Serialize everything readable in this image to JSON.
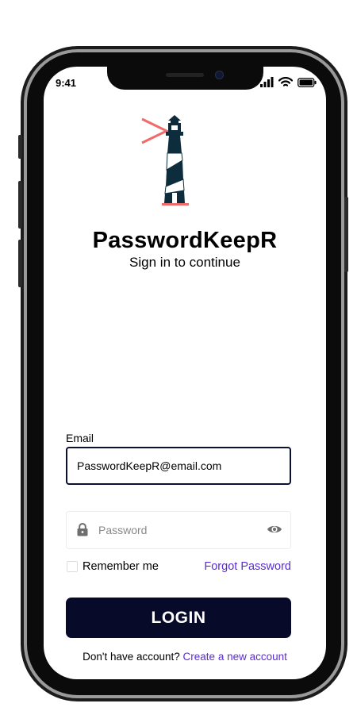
{
  "status_bar": {
    "time": "9:41",
    "icons": [
      "signal-icon",
      "wifi-icon",
      "battery-icon"
    ]
  },
  "app": {
    "title": "PasswordKeepR",
    "subtitle": "Sign in to continue",
    "logo_icon": "lighthouse-logo-icon",
    "colors": {
      "primary": "#070a28",
      "logo_dark": "#0d2d3d",
      "logo_accent": "#f06a6a",
      "link": "#5b2bd8"
    }
  },
  "form": {
    "email_label": "Email",
    "email_value": "PasswordKeepR@email.com",
    "password_placeholder": "Password",
    "remember_label": "Remember me",
    "forgot_label": "Forgot Password",
    "login_label": "LOGIN"
  },
  "footer": {
    "prompt": "Don't have account?",
    "link": "Create a new account"
  }
}
